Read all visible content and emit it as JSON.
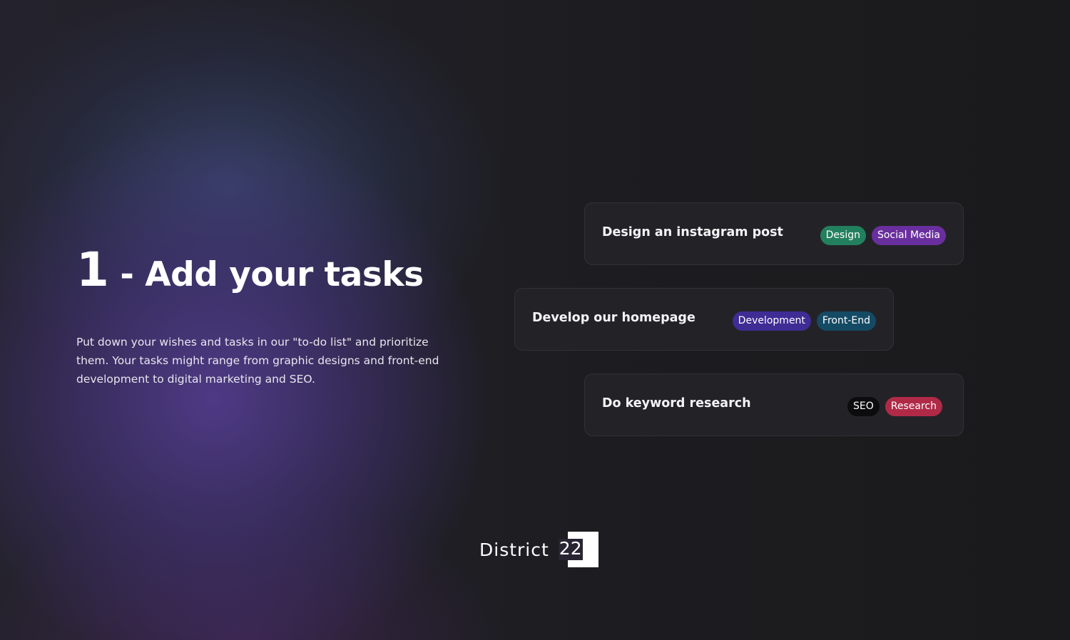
{
  "hero": {
    "number": "1",
    "separator": "-",
    "title": "Add your tasks",
    "description": "Put down your wishes and tasks in our \"to-do list\" and prioritize them. Your tasks might range from graphic designs and front-end development to digital marketing and SEO."
  },
  "tasks": [
    {
      "title": "Design an instagram post",
      "tags": [
        {
          "label": "Design",
          "color": "#23805f"
        },
        {
          "label": "Social Media",
          "color": "#6a2f9e"
        }
      ]
    },
    {
      "title": "Develop our homepage",
      "tags": [
        {
          "label": "Development",
          "color": "#3f2c94"
        },
        {
          "label": "Front-End",
          "color": "#144a64"
        }
      ]
    },
    {
      "title": "Do keyword research",
      "tags": [
        {
          "label": "SEO",
          "color": "#0c0c0e"
        },
        {
          "label": "Research",
          "color": "#b02a48"
        }
      ]
    }
  ],
  "brand": {
    "name": "District",
    "number": "22"
  }
}
